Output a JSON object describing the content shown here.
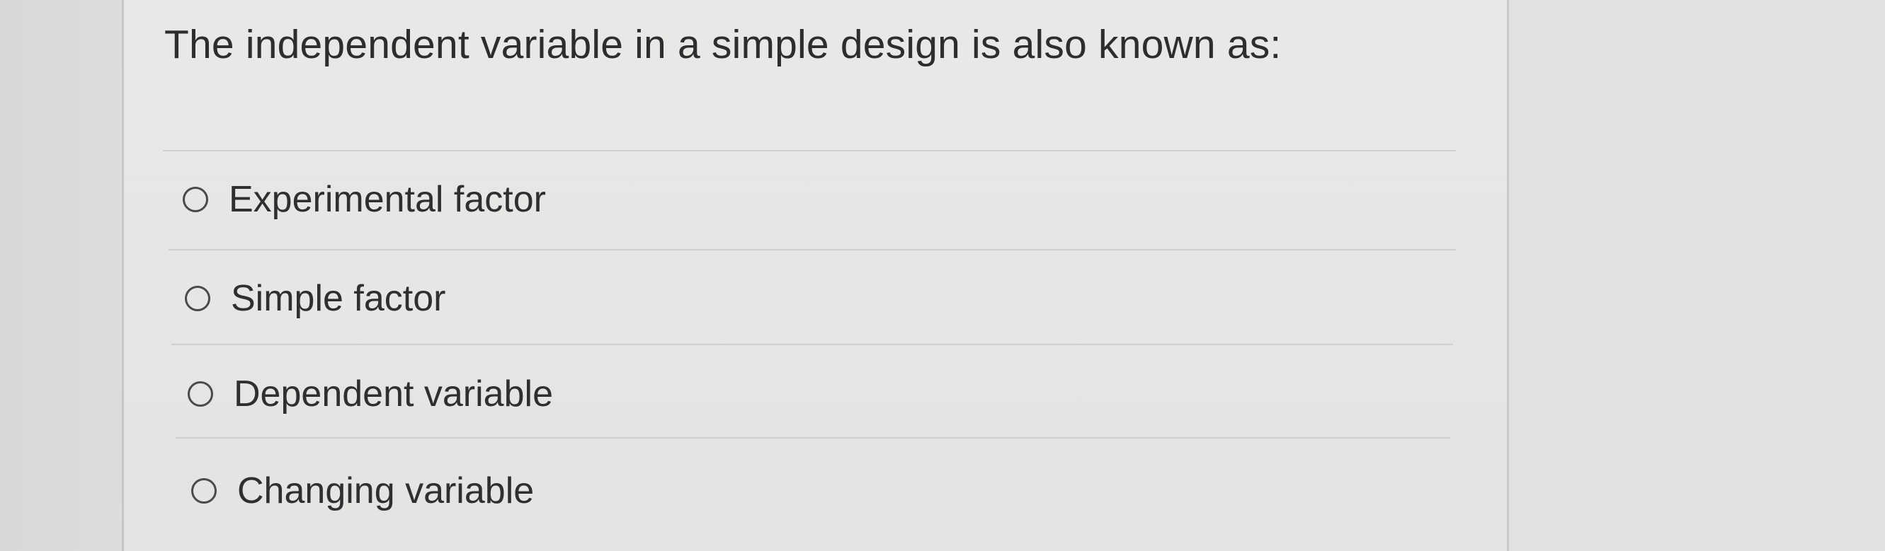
{
  "question": {
    "text": "The independent variable in a simple design is also known as:"
  },
  "options": [
    {
      "label": "Experimental factor",
      "selected": false
    },
    {
      "label": "Simple factor",
      "selected": false
    },
    {
      "label": "Dependent variable",
      "selected": false
    },
    {
      "label": "Changing variable",
      "selected": false
    }
  ]
}
